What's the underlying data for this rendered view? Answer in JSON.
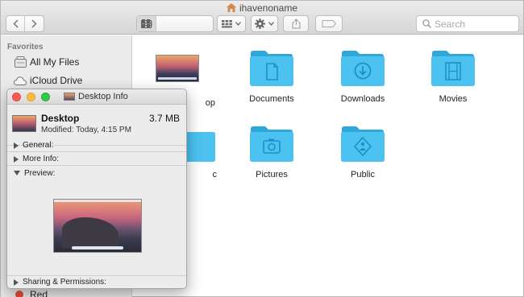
{
  "window": {
    "title": "ihavenoname",
    "search_placeholder": "Search"
  },
  "sidebar": {
    "heading": "Favorites",
    "items": [
      {
        "label": "All My Files",
        "icon": "all-files-icon"
      },
      {
        "label": "iCloud Drive",
        "icon": "cloud-icon"
      }
    ],
    "tag_label": "Red",
    "tag_color": "#e74c3c"
  },
  "files": [
    {
      "label": "op",
      "icon": "desktop-thumbnail"
    },
    {
      "label": "Documents",
      "icon": "documents-folder-icon"
    },
    {
      "label": "Downloads",
      "icon": "downloads-folder-icon"
    },
    {
      "label": "Movies",
      "icon": "movies-folder-icon"
    },
    {
      "label": "c",
      "icon": "music-folder-icon"
    },
    {
      "label": "Pictures",
      "icon": "pictures-folder-icon"
    },
    {
      "label": "Public",
      "icon": "public-folder-icon"
    }
  ],
  "info_panel": {
    "title": "Desktop Info",
    "name": "Desktop",
    "size": "3.7 MB",
    "modified": "Modified: Today, 4:15 PM",
    "sections": {
      "general": "General:",
      "more_info": "More Info:",
      "preview": "Preview:",
      "sharing": "Sharing & Permissions:"
    }
  },
  "colors": {
    "folder": "#4cc2f1",
    "folder_dark": "#2ea8db",
    "folder_glyph": "#1f8fc4"
  }
}
